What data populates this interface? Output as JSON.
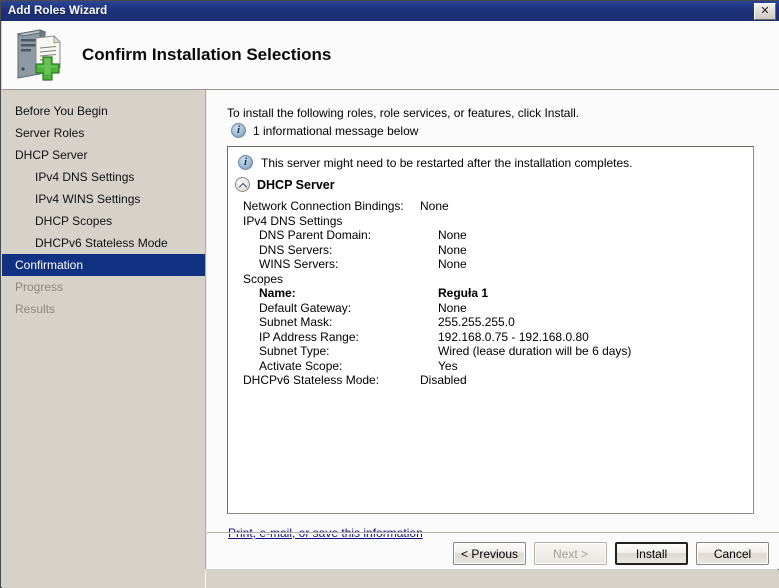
{
  "window": {
    "title": "Add Roles Wizard",
    "close_label": "✕"
  },
  "header": {
    "title": "Confirm Installation Selections",
    "icon": "server-add-icon"
  },
  "sidebar": {
    "items": [
      {
        "label": "Before You Begin",
        "level": 0,
        "state": "normal"
      },
      {
        "label": "Server Roles",
        "level": 0,
        "state": "normal"
      },
      {
        "label": "DHCP Server",
        "level": 0,
        "state": "normal"
      },
      {
        "label": "IPv4 DNS Settings",
        "level": 1,
        "state": "normal"
      },
      {
        "label": "IPv4 WINS Settings",
        "level": 1,
        "state": "normal"
      },
      {
        "label": "DHCP Scopes",
        "level": 1,
        "state": "normal"
      },
      {
        "label": "DHCPv6 Stateless Mode",
        "level": 1,
        "state": "normal"
      },
      {
        "label": "Confirmation",
        "level": 0,
        "state": "selected"
      },
      {
        "label": "Progress",
        "level": 0,
        "state": "disabled"
      },
      {
        "label": "Results",
        "level": 0,
        "state": "disabled"
      }
    ]
  },
  "main": {
    "intro": "To install the following roles, role services, or features, click Install.",
    "message_count_text": "1 informational message below",
    "info_glyph": "i",
    "panel": {
      "warning_text": "This server might need to be restarted after the installation completes.",
      "role_name": "DHCP Server",
      "rows": [
        {
          "key": "Network Connection Bindings:",
          "value": "None",
          "indent": 0,
          "bold": false
        },
        {
          "key": "IPv4 DNS Settings",
          "value": "",
          "indent": 0,
          "bold": false
        },
        {
          "key": "DNS Parent Domain:",
          "value": "None",
          "indent": 1,
          "bold": false
        },
        {
          "key": "DNS Servers:",
          "value": "None",
          "indent": 1,
          "bold": false
        },
        {
          "key": "WINS Servers:",
          "value": "None",
          "indent": 1,
          "bold": false
        },
        {
          "key": "Scopes",
          "value": "",
          "indent": 0,
          "bold": false
        },
        {
          "key": "Name:",
          "value": "Reguła 1",
          "indent": 1,
          "bold": true
        },
        {
          "key": "Default Gateway:",
          "value": "None",
          "indent": 1,
          "bold": false
        },
        {
          "key": "Subnet Mask:",
          "value": "255.255.255.0",
          "indent": 1,
          "bold": false
        },
        {
          "key": "IP Address Range:",
          "value": "192.168.0.75 - 192.168.0.80",
          "indent": 1,
          "bold": false
        },
        {
          "key": "Subnet Type:",
          "value": "Wired (lease duration will be 6 days)",
          "indent": 1,
          "bold": false
        },
        {
          "key": "Activate Scope:",
          "value": "Yes",
          "indent": 1,
          "bold": false
        },
        {
          "key": "DHCPv6 Stateless Mode:",
          "value": "Disabled",
          "indent": 0,
          "bold": false
        }
      ]
    },
    "print_link": "Print, e-mail, or save this information"
  },
  "footer": {
    "buttons": [
      {
        "label": "< Previous",
        "state": "normal"
      },
      {
        "label": "Next >",
        "state": "disabled"
      },
      {
        "label": "Install",
        "state": "default"
      },
      {
        "label": "Cancel",
        "state": "normal"
      }
    ]
  },
  "colors": {
    "titlebar": "#1d3179",
    "selection": "#113183",
    "link": "#11117f",
    "chrome": "#d6d2ca",
    "content": "#fbfbfb"
  }
}
